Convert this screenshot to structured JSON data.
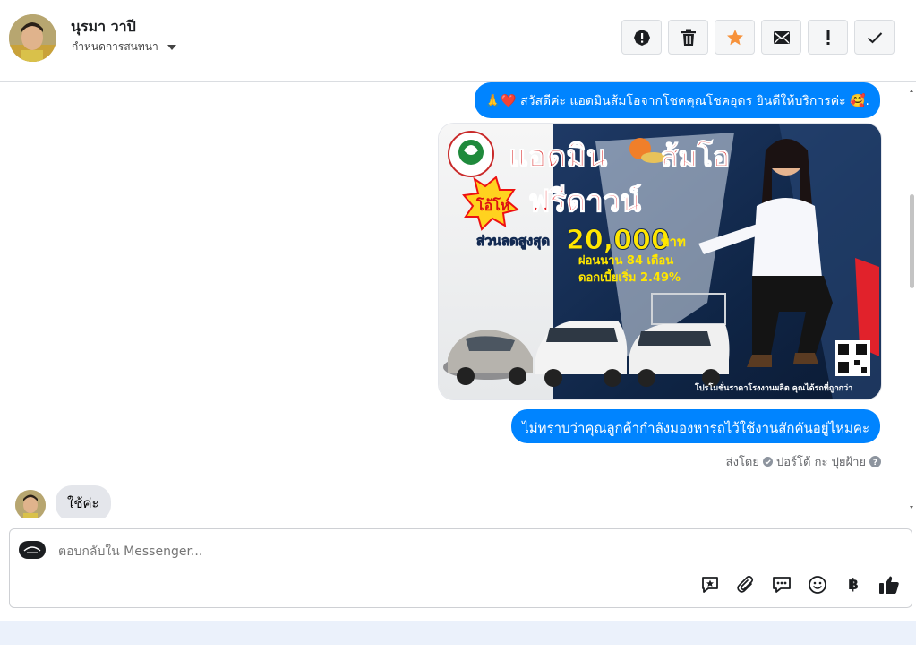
{
  "header": {
    "contact_name": "นุรมา วาปี",
    "assign_label": "กำหนดการสนทนา",
    "actions": [
      {
        "name": "report-spam-button",
        "icon": "exclamation-circle-icon"
      },
      {
        "name": "delete-button",
        "icon": "trash-icon"
      },
      {
        "name": "star-button",
        "icon": "star-icon"
      },
      {
        "name": "mark-unread-button",
        "icon": "envelope-icon"
      },
      {
        "name": "important-button",
        "icon": "exclamation-icon"
      },
      {
        "name": "mark-done-button",
        "icon": "check-icon"
      }
    ]
  },
  "thread": {
    "messages": [
      {
        "from": "page",
        "text": "🙏❤️ สวัสดีค่ะ แอดมินส้มโอจากโชคคุณโชคอุดร ยินดีให้บริการค่ะ 🥰."
      },
      {
        "from": "page",
        "type": "image",
        "image_text": {
          "title_left": "แอดมิน",
          "title_right": "ส้มโอ",
          "burst": "โอ้โห",
          "headline": "ฟรีดาวน์",
          "discount_prefix": "ส่วนลดสูงสุด",
          "discount_amount": "20,000",
          "discount_unit": "บาท",
          "installment": "ผ่อนนาน 84 เดือน",
          "interest": "ดอกเบี้ยเริ่ม 2.49%",
          "footer": "โปรโมชั่นราคาโรงงานผลิต คุณได้รถที่ถูกกว่า"
        }
      },
      {
        "from": "page",
        "text": "ไม่ทราบว่าคุณลูกค้ากำลังมองหารถไว้ใช้งานสักคันอยู่ไหมคะ"
      },
      {
        "from": "customer",
        "text": "ใช้ค่ะ"
      }
    ],
    "sent_by_prefix": "ส่งโดย",
    "sent_by_name": "ปอร์โต้ กะ ปุยฝ้าย"
  },
  "composer": {
    "placeholder": "ตอบกลับใน Messenger...",
    "actions": [
      "saved-reply-icon",
      "paperclip-icon",
      "chat-bubble-icon",
      "emoji-icon",
      "baht-icon",
      "thumbs-up-icon"
    ],
    "currency_symbol": "฿"
  },
  "colors": {
    "brand_blue": "#0084ff",
    "star_orange": "#f7923b",
    "incoming_bubble": "#e4e6eb"
  }
}
